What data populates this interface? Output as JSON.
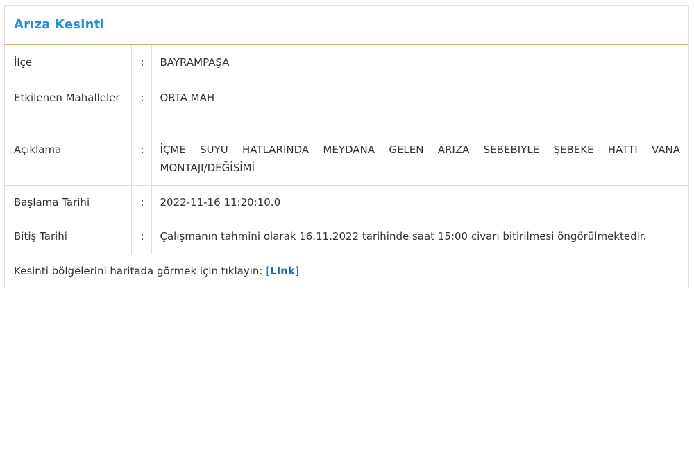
{
  "panel": {
    "title": "Arıza Kesinti"
  },
  "rows": [
    {
      "label": "İlçe",
      "separator": ":",
      "value": "BAYRAMPAŞA"
    },
    {
      "label": "Etkilenen Mahalleler",
      "separator": ":",
      "value": "ORTA MAH"
    },
    {
      "label": "Açıklama",
      "separator": ":",
      "value": "İÇME SUYU HATLARINDA MEYDANA GELEN ARIZA SEBEBIYLE ŞEBEKE HATTI VANA MONTAJI/DEĞİŞİMİ"
    },
    {
      "label": "Başlama Tarihi",
      "separator": ":",
      "value": "2022-11-16 11:20:10.0"
    },
    {
      "label": "Bitiş Tarihi",
      "separator": ":",
      "value": "Çalışmanın tahmini olarak 16.11.2022 tarihinde saat 15:00 civarı bitirilmesi öngörülmektedir."
    }
  ],
  "footer": {
    "text": "Kesinti bölgelerini haritada görmek için tıklayın: ",
    "bracket_open": "[",
    "link_label": "LInk",
    "bracket_close": "]"
  }
}
